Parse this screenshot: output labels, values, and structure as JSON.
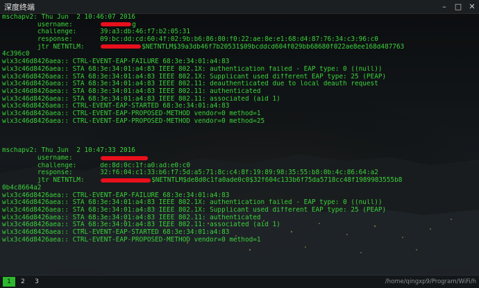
{
  "window": {
    "title": "深度终端",
    "minimize_glyph": "–",
    "maximize_glyph": "□",
    "close_glyph": "✕"
  },
  "colors": {
    "terminal_text": "#3bd23b",
    "redaction": "#e8101c",
    "active_tab": "#2db82d"
  },
  "icons": {
    "minimize": "minimize-icon",
    "maximize": "maximize-icon",
    "close": "close-icon"
  },
  "block1": {
    "header": "mschapv2: Thu Jun  2 10:46:07 2016",
    "username_label": "username:",
    "username_value": "g",
    "challenge_label": "challenge:",
    "challenge_value": "39:a3:db:46:f7:b2:05:31",
    "response_label": "response:",
    "response_value": "09:bc:dd:cd:60:4f:02:9b:b6:86:80:f0:22:ae:8e:e1:68:d4:87:76:34:c3:96:c0",
    "jtr_label": "jtr NETNTLM:",
    "jtr_value": "$NETNTLM$39a3db46f7b20531$09bcddcd604f029bb68680f022ae8ee168d487763",
    "jtr_cont": "4c396c0",
    "log": [
      "wlx3c46d8426aea:: CTRL-EVENT-EAP-FAILURE 68:3e:34:01:a4:83",
      "wlx3c46d8426aea:: STA 68:3e:34:01:a4:83 IEEE 802.1X: authentication failed - EAP type: 0 ((null))",
      "wlx3c46d8426aea:: STA 68:3e:34:01:a4:83 IEEE 802.1X: Supplicant used different EAP type: 25 (PEAP)",
      "wlx3c46d8426aea:: STA 68:3e:34:01:a4:83 IEEE 802.11: deauthenticated due to local deauth request",
      "wlx3c46d8426aea:: STA 68:3e:34:01:a4:83 IEEE 802.11: authenticated",
      "wlx3c46d8426aea:: STA 68:3e:34:01:a4:83 IEEE 802.11: associated (aid 1)",
      "wlx3c46d8426aea:: CTRL-EVENT-EAP-STARTED 68:3e:34:01:a4:83",
      "wlx3c46d8426aea:: CTRL-EVENT-EAP-PROPOSED-METHOD vendor=0 method=1",
      "wlx3c46d8426aea:: CTRL-EVENT-EAP-PROPOSED-METHOD vendor=0 method=25"
    ]
  },
  "block2": {
    "header": "mschapv2: Thu Jun  2 10:47:33 2016",
    "username_label": "username:",
    "username_value": "",
    "challenge_label": "challenge:",
    "challenge_value": "de:8d:0c:1f:a0:ad:e0:c0",
    "response_label": "response:",
    "response_value": "32:f6:04:c1:33:b6:f7:5d:a5:71:8c:c4:8f:19:89:98:35:55:b8:0b:4c:86:64:a2",
    "jtr_label": "jtr NETNTLM:",
    "jtr_value": "$NETNTLM$de8d0c1fa0ade0c0$32f604c133b6f75da5718cc48f1989983555b8",
    "jtr_cont": "0b4c8664a2",
    "log": [
      "wlx3c46d8426aea:: CTRL-EVENT-EAP-FAILURE 68:3e:34:01:a4:83",
      "wlx3c46d8426aea:: STA 68:3e:34:01:a4:83 IEEE 802.1X: authentication failed - EAP type: 0 ((null))",
      "wlx3c46d8426aea:: STA 68:3e:34:01:a4:83 IEEE 802.1X: Supplicant used different EAP type: 25 (PEAP)",
      "wlx3c46d8426aea:: STA 68:3e:34:01:a4:83 IEEE 802.11: authenticated",
      "wlx3c46d8426aea:: STA 68:3e:34:01:a4:83 IEEE 802.11: associated (aid 1)",
      "wlx3c46d8426aea:: CTRL-EVENT-EAP-STARTED 68:3e:34:01:a4:83",
      "wlx3c46d8426aea:: CTRL-EVENT-EAP-PROPOSED-METHOD vendor=0 method=1"
    ]
  },
  "statusbar": {
    "tabs": [
      "1",
      "2",
      "3"
    ],
    "active_tab": "1",
    "path": "/home/qingxp9/Program/WiFi/h"
  }
}
